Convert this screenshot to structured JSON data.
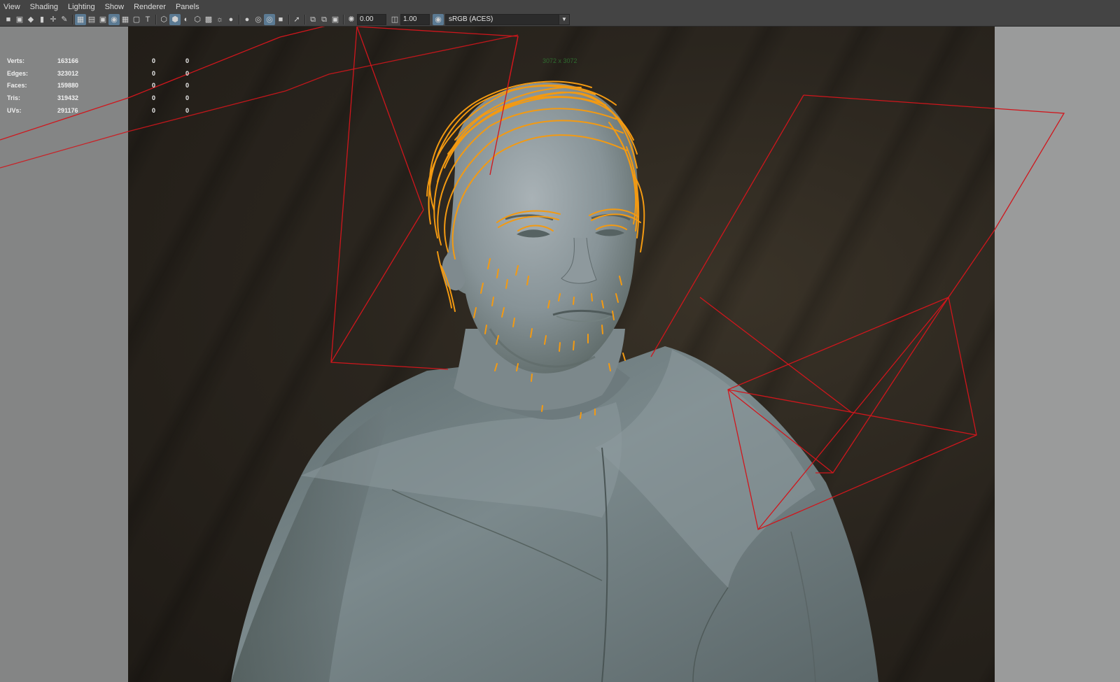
{
  "menubar": {
    "items": [
      "View",
      "Shading",
      "Lighting",
      "Show",
      "Renderer",
      "Panels"
    ]
  },
  "toolbar": {
    "exposure": "0.00",
    "gamma": "1.00",
    "color_space": "sRGB (ACES)"
  },
  "hud": {
    "rows": [
      {
        "label": "Verts:",
        "value": "163166",
        "selected": "0",
        "components": "0"
      },
      {
        "label": "Edges:",
        "value": "323012",
        "selected": "0",
        "components": "0"
      },
      {
        "label": "Faces:",
        "value": "159880",
        "selected": "0",
        "components": "0"
      },
      {
        "label": "Tris:",
        "value": "319432",
        "selected": "0",
        "components": "0"
      },
      {
        "label": "UVs:",
        "value": "291176",
        "selected": "0",
        "components": "0"
      }
    ],
    "resolution": "3072 x 3072"
  },
  "colors": {
    "hair_curves": "#f39a12",
    "light_wireframe": "#d0161c",
    "mesh_shading": "#7d8a8e",
    "menu_bg": "#444444"
  }
}
